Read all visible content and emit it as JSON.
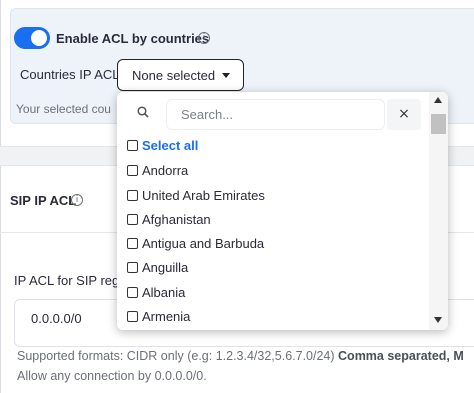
{
  "acl": {
    "enable_label": "Enable ACL by countries",
    "countries_label": "Countries IP ACL",
    "select_value": "None selected",
    "selected_text": "Your selected cou",
    "toggle_color": "#1a6ff0",
    "toggle_on": true
  },
  "sip": {
    "title": "SIP IP ACL",
    "regi_label": "IP ACL for SIP regi",
    "ip_value": "0.0.0.0/0",
    "formats_prefix": "Supported formats: CIDR only (e.g: 1.2.3.4/32,5.6.7.0/24)",
    "formats_bold": "Comma separated, M",
    "allow_text": "Allow any connection by 0.0.0.0/0."
  },
  "dropdown": {
    "search_placeholder": "Search...",
    "close_glyph": "×",
    "select_all": "Select all",
    "options": [
      "Andorra",
      "United Arab Emirates",
      "Afghanistan",
      "Antigua and Barbuda",
      "Anguilla",
      "Albania",
      "Armenia"
    ]
  },
  "icons": {
    "info": "i"
  }
}
